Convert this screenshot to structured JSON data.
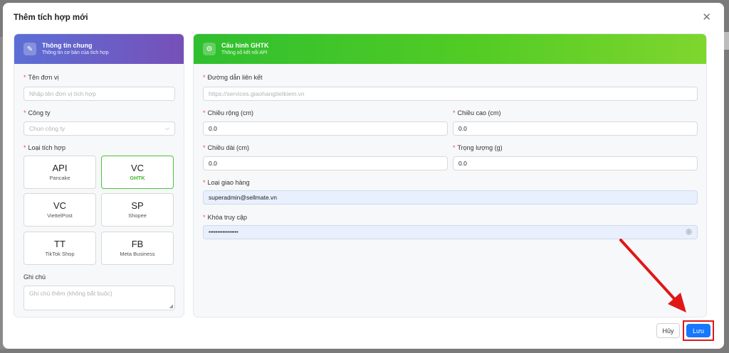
{
  "modal": {
    "title": "Thêm tích hợp mới",
    "close_glyph": "✕"
  },
  "left_panel": {
    "title": "Thông tin chung",
    "subtitle": "Thông tin cơ bản của tích hợp",
    "fields": {
      "unit_name": {
        "label": "Tên đơn vị",
        "placeholder": "Nhập tên đơn vị tích hợp"
      },
      "company": {
        "label": "Công ty",
        "placeholder": "Chọn công ty"
      },
      "integration_type": {
        "label": "Loại tích hợp"
      },
      "note": {
        "label": "Ghi chú",
        "placeholder": "Ghi chú thêm (không bắt buộc)"
      }
    },
    "tiles": [
      {
        "code": "API",
        "name": "Pancake",
        "active": false
      },
      {
        "code": "VC",
        "name": "GHTK",
        "active": true
      },
      {
        "code": "VC",
        "name": "ViettelPost",
        "active": false
      },
      {
        "code": "SP",
        "name": "Shopee",
        "active": false
      },
      {
        "code": "TT",
        "name": "TikTok Shop",
        "active": false
      },
      {
        "code": "FB",
        "name": "Meta Business",
        "active": false
      }
    ]
  },
  "right_panel": {
    "title": "Cấu hình GHTK",
    "subtitle": "Thông số kết nối API",
    "fields": {
      "link": {
        "label": "Đường dẫn liên kết",
        "placeholder": "https://services.giaohangtietkiem.vn"
      },
      "width": {
        "label": "Chiều rộng (cm)",
        "value": "0.0"
      },
      "height": {
        "label": "Chiều cao (cm)",
        "value": "0.0"
      },
      "length": {
        "label": "Chiều dài (cm)",
        "value": "0.0"
      },
      "weight": {
        "label": "Trọng lượng (g)",
        "value": "0.0"
      },
      "delivery_type": {
        "label": "Loại giao hàng",
        "value": "superadmin@sellmate.vn"
      },
      "access_key": {
        "label": "Khóa truy cập",
        "value": "•••••••••••••••••"
      }
    }
  },
  "footer": {
    "cancel_label": "Hủy",
    "save_label": "Lưu"
  },
  "colors": {
    "primary": "#1677ff",
    "green": "#52c41a",
    "purple": "#7750b8",
    "highlight": "#e01717"
  }
}
